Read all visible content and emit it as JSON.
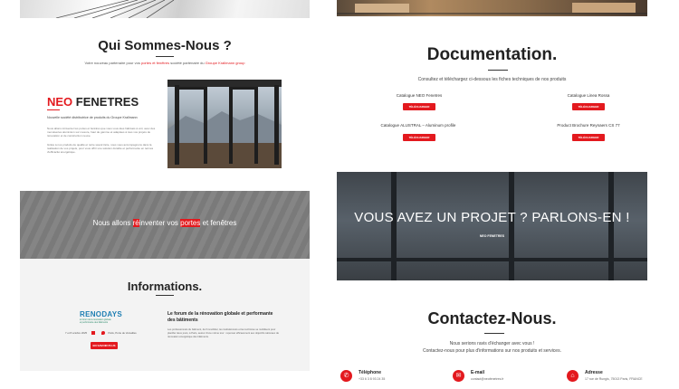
{
  "about": {
    "title": "Qui Sommes-Nous ?",
    "intro_pre": "Votre nouveau partenaire pour vos ",
    "intro_link1": "portes et fenêtres",
    "intro_mid": " société partenaire du ",
    "intro_link2": "Groupe Krallmann group",
    "brand_neo": "NEO",
    "brand_fenetres": " FENETRES",
    "brand_sub": "Nouvelle société distributrice de produits du Groupe Krallmann",
    "p1": "Nous allons réinventer les portes et fenêtres que vous vous êtes habitués à voir, avec des menuiseries aluminium sur mesure, haut de gamme et adaptées à tous vos projets de rénovation et de construction neuve.",
    "p2": "Grâce à nos produits de qualité et notre savoir-faire, nous vous accompagnons dans la réalisation de vos projets, pour vous offrir une solution durable et performante en termes d'efficacité énergétique."
  },
  "banner": {
    "pre": "Nous allons ",
    "hl1": "ré",
    "mid": "inventer vos ",
    "hl2": "portes",
    "post": " et fenêtres"
  },
  "info": {
    "title": "Informations.",
    "logo_top": "RENODAYS",
    "logo_sub1": "le forum de la rénovation globale",
    "logo_sub2": "et performante des bâtiments",
    "date": "7 et 8 octobre 2025",
    "place": "Paris, Porte de Versailles",
    "button": "EN SAVOIR PLUS",
    "heading": "Le forum de la rénovation globale et performante des bâtiments",
    "body": "Les professionnels du bâtiment, de l'immobilier, les institutionnels et les territoires se mobilisent pour planifier deux jours, à Paris, autour d'une même tour : repenser efficacement aux objectifs nationaux de rénovation énergétique des bâtiments."
  },
  "docs": {
    "title": "Documentation.",
    "subtitle": "Consultez et téléchargez ci-dessous les fiches techniques de nos produits",
    "items": [
      {
        "label": "Catalogue NEO Fenetres",
        "button": "TÉLÉCHARGER"
      },
      {
        "label": "Catalogue Linea Rossa",
        "button": "TÉLÉCHARGER"
      },
      {
        "label": "Catalogue ALUSTRAL – Aluminum profile",
        "button": "TÉLÉCHARGER"
      },
      {
        "label": "Product Brochure Reynaers CS 77",
        "button": "TÉLÉCHARGER"
      }
    ]
  },
  "project": {
    "heading": "VOUS AVEZ UN PROJET ? PARLONS-EN !",
    "logo": "NEO FENETRES"
  },
  "contact": {
    "title": "Contactez-Nous.",
    "line1": "Nous serions ravis d'échanger avec vous !",
    "line2": "Contactez-nous pour plus d'informations sur nos produits et services.",
    "phone_label": "Téléphone",
    "phone_value": "+33 6 3 8 93 24 35",
    "email_label": "E-mail",
    "email_value": "contact@neofenetres.fr",
    "address_label": "Adresse",
    "address_value": "17 rue de Rungis, 75013 Paris, FRANCE"
  },
  "colors": {
    "accent": "#e3191e",
    "banner_bg": "#7a7a7a",
    "info_bg": "#f3f3f3",
    "project_bg": "#4a4f55"
  }
}
